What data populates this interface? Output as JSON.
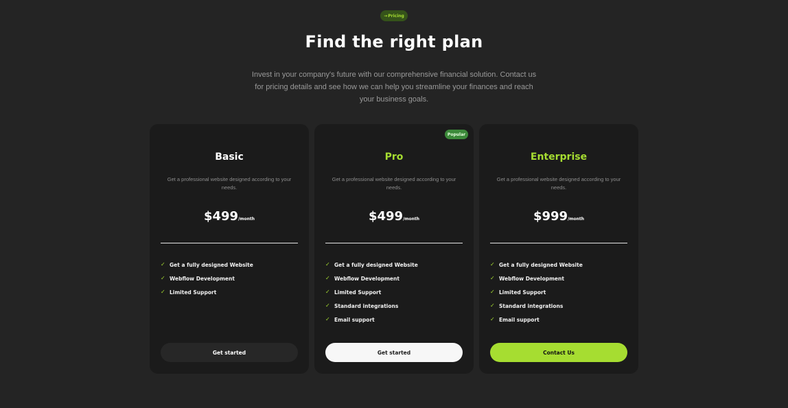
{
  "section_tag": {
    "arrow": "→",
    "label": "Pricing"
  },
  "title": "Find the right plan",
  "subtitle": "Invest in your company's future with our comprehensive financial solution. Contact us for pricing details and see how we can help you streamline your finances and reach your business goals.",
  "colors": {
    "background": "#242424",
    "card": "#1b1b1b",
    "accent": "#a6dd31",
    "popular_badge": "#3c8a3a"
  },
  "plans": [
    {
      "name": "Basic",
      "description": "Get a professional website designed according to your needs.",
      "price": "$499",
      "period": "/month",
      "features": [
        "Get a fully designed Website",
        "Webflow Development",
        "Limited Support"
      ],
      "cta": "Get started"
    },
    {
      "name": "Pro",
      "badge": "Popular",
      "description": "Get a professional website designed according to your needs.",
      "price": "$499",
      "period": "/month",
      "features": [
        "Get a fully designed Website",
        "Webflow Development",
        "Limited Support",
        "Standard integrations",
        "Email support"
      ],
      "cta": "Get started"
    },
    {
      "name": "Enterprise",
      "description": "Get a professional website designed according to your needs.",
      "price": "$999",
      "period": "/month",
      "features": [
        "Get a fully designed Website",
        "Webflow Development",
        "Limited Support",
        "Standard integrations",
        "Email support"
      ],
      "cta": "Contact Us"
    }
  ],
  "check_icon": "check-icon"
}
